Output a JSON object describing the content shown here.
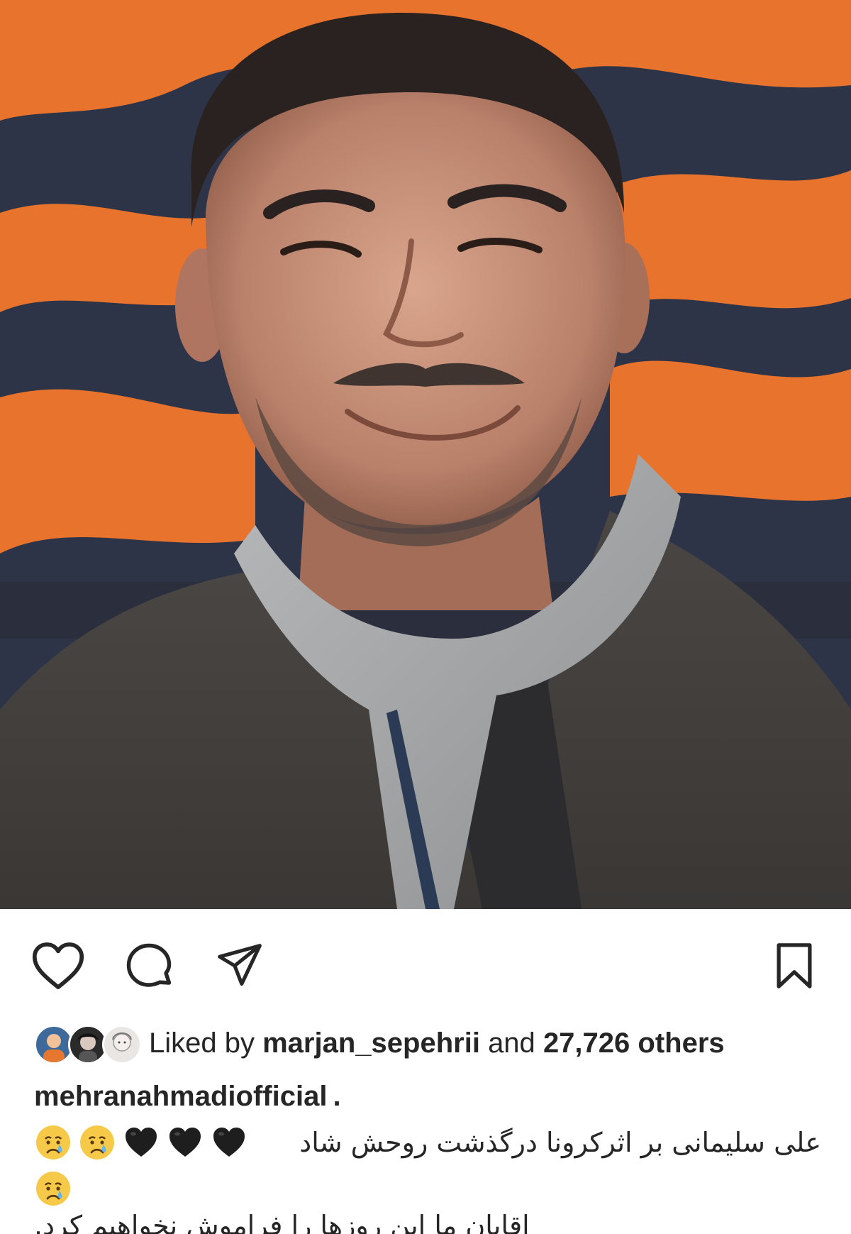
{
  "post": {
    "likes": {
      "prefix": "Liked by",
      "user": "marjan_sepehrii",
      "joiner": "and",
      "count_text": "27,726 others"
    },
    "caption": {
      "username": "mehranahmadiofficial",
      "username_suffix": ".",
      "line1_text": "علی سلیمانی بر اثرکرونا درگذشت روحش شاد",
      "line1_hearts": [
        "🖤",
        "🖤",
        "🖤"
      ],
      "line1_emojis": [
        "😢",
        "😢"
      ],
      "line2_emojis": [
        "😢"
      ],
      "line3_text": "اقایان ما این روزها را فراموش نخواهیم کرد."
    },
    "icons": {
      "like": "heart-outline-icon",
      "comment": "comment-bubble-icon",
      "share": "paper-plane-icon",
      "save": "bookmark-icon"
    },
    "colors": {
      "text": "#262626",
      "background": "#ffffff",
      "photo_backdrop_orange": "#e8732d",
      "photo_backdrop_navy": "#2e3448"
    }
  }
}
